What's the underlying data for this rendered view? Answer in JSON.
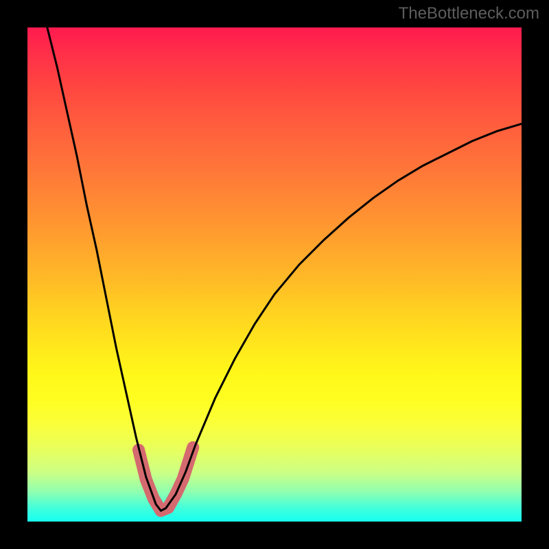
{
  "watermark": "TheBottleneck.com",
  "chart_data": {
    "type": "line",
    "title": "",
    "xlabel": "",
    "ylabel": "",
    "description": "Bottleneck curve on a red-to-green vertical gradient. A single V-shaped curve with its minimum near x≈0.27 of the plot width, reaching the bottom (best / green) region. The left branch rises steeply to the top-left; the right branch rises more gently toward the upper-right. A thick pink highlight marks the trough region (approximately x 0.23 to 0.34) where the curve is within the green/yellow band.",
    "xlim": [
      0,
      1
    ],
    "ylim": [
      0,
      1
    ],
    "series": [
      {
        "name": "bottleneck-curve",
        "x": [
          0.04,
          0.06,
          0.08,
          0.1,
          0.12,
          0.14,
          0.16,
          0.18,
          0.2,
          0.22,
          0.24,
          0.26,
          0.27,
          0.28,
          0.3,
          0.32,
          0.34,
          0.38,
          0.42,
          0.46,
          0.5,
          0.55,
          0.6,
          0.65,
          0.7,
          0.75,
          0.8,
          0.85,
          0.9,
          0.95,
          1.0
        ],
        "y": [
          1.0,
          0.92,
          0.83,
          0.74,
          0.64,
          0.55,
          0.45,
          0.35,
          0.26,
          0.17,
          0.09,
          0.035,
          0.022,
          0.027,
          0.055,
          0.1,
          0.155,
          0.25,
          0.33,
          0.4,
          0.46,
          0.52,
          0.57,
          0.615,
          0.655,
          0.69,
          0.72,
          0.745,
          0.77,
          0.79,
          0.805
        ]
      }
    ],
    "highlight_region": {
      "note": "Thick pink stroke over the trough of the curve (optimal zone)",
      "x": [
        0.225,
        0.24,
        0.255,
        0.27,
        0.285,
        0.3,
        0.315,
        0.335
      ],
      "y": [
        0.145,
        0.085,
        0.047,
        0.022,
        0.028,
        0.055,
        0.087,
        0.15
      ]
    },
    "background_gradient": {
      "direction": "vertical",
      "stops": [
        {
          "pos": 0.0,
          "color": "#ff1a4f",
          "meaning": "worst"
        },
        {
          "pos": 0.5,
          "color": "#ffb728"
        },
        {
          "pos": 0.75,
          "color": "#fffd20"
        },
        {
          "pos": 1.0,
          "color": "#1bffee",
          "meaning": "best"
        }
      ]
    }
  }
}
